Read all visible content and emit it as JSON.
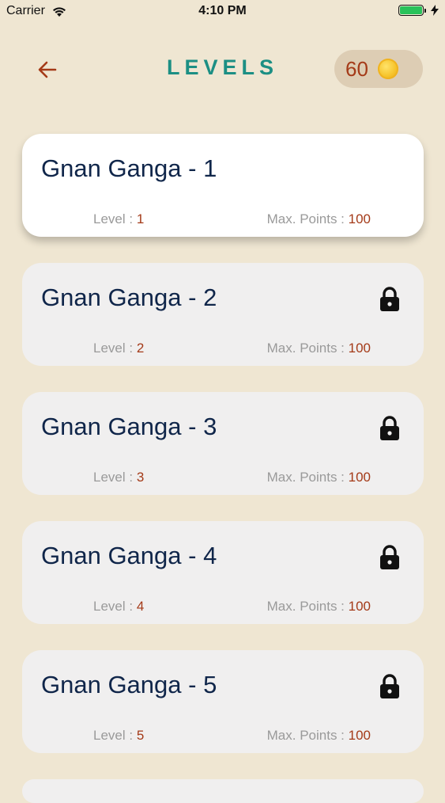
{
  "status_bar": {
    "carrier": "Carrier",
    "time": "4:10 PM",
    "battery_color": "#29C25A"
  },
  "header": {
    "back_icon": "arrow-left-icon",
    "title": "LEVELS",
    "coins": "60",
    "coin_icon": "gold-coin-icon"
  },
  "colors": {
    "background": "#EFE6D2",
    "title": "#1C8F84",
    "accent": "#A43A18",
    "level_name": "#10264A"
  },
  "labels": {
    "level": "Level : ",
    "max_points": "Max. Points : "
  },
  "levels": [
    {
      "name": "Gnan Ganga - 1",
      "level": "1",
      "max_points": "100",
      "locked": false
    },
    {
      "name": "Gnan Ganga - 2",
      "level": "2",
      "max_points": "100",
      "locked": true
    },
    {
      "name": "Gnan Ganga - 3",
      "level": "3",
      "max_points": "100",
      "locked": true
    },
    {
      "name": "Gnan Ganga - 4",
      "level": "4",
      "max_points": "100",
      "locked": true
    },
    {
      "name": "Gnan Ganga - 5",
      "level": "5",
      "max_points": "100",
      "locked": true
    }
  ]
}
